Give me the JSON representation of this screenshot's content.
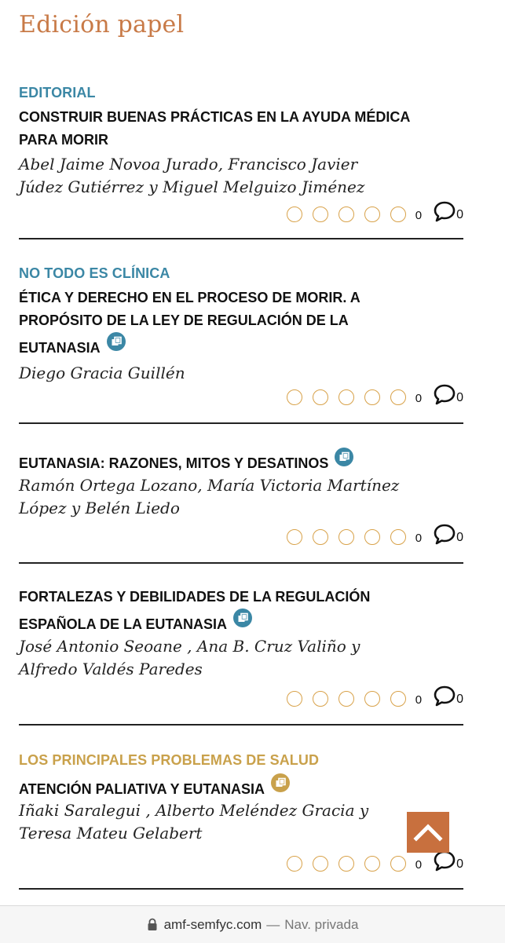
{
  "page": {
    "title": "Edición papel"
  },
  "colors": {
    "accent": "#c87a47",
    "section_blue": "#3b87a5",
    "section_gold": "#c9a14b",
    "star": "#d8a24a",
    "scroll_button": "#c8703e"
  },
  "articles": [
    {
      "section": "EDITORIAL",
      "title_lines": [
        "CONSTRUIR BUENAS PRÁCTICAS EN LA AYUDA MÉDICA",
        "PARA MORIR"
      ],
      "authors_lines": [
        "Abel Jaime Novoa Jurado, Francisco Javier",
        "Júdez Gutiérrez y Miguel Melguizo Jiménez"
      ],
      "has_open_icon": false,
      "rating_count": "0",
      "comment_count": "0"
    },
    {
      "section": "NO TODO ES CLÍNICA",
      "title_lines": [
        "ÉTICA Y DERECHO EN EL PROCESO DE MORIR. A",
        "PROPÓSITO DE LA LEY DE REGULACIÓN DE LA",
        "EUTANASIA"
      ],
      "authors_lines": [
        "Diego Gracia Guillén"
      ],
      "has_open_icon": true,
      "rating_count": "0",
      "comment_count": "0"
    },
    {
      "section": "",
      "title_lines": [
        "EUTANASIA: RAZONES, MITOS Y DESATINOS"
      ],
      "authors_lines": [
        "Ramón Ortega Lozano, María Victoria Martínez",
        "López y Belén Liedo"
      ],
      "has_open_icon": true,
      "rating_count": "0",
      "comment_count": "0"
    },
    {
      "section": "",
      "title_lines": [
        "FORTALEZAS Y DEBILIDADES DE LA REGULACIÓN",
        "ESPAÑOLA DE LA EUTANASIA"
      ],
      "authors_lines": [
        "José Antonio Seoane , Ana B. Cruz Valiño y",
        "Alfredo Valdés Paredes"
      ],
      "has_open_icon": true,
      "rating_count": "0",
      "comment_count": "0"
    },
    {
      "section": "LOS PRINCIPALES PROBLEMAS DE SALUD",
      "title_lines": [
        "ATENCIÓN PALIATIVA Y EUTANASIA"
      ],
      "authors_lines": [
        "Iñaki Saralegui , Alberto Meléndez Gracia y",
        "Teresa Mateu Gelabert"
      ],
      "has_open_icon": true,
      "rating_count": "0",
      "comment_count": "0"
    }
  ],
  "browser": {
    "domain": "amf-semfyc.com",
    "separator": "—",
    "mode": "Nav. privada",
    "lock_icon": "lock-icon"
  },
  "scroll_top": {
    "icon": "chevron-up-icon"
  }
}
